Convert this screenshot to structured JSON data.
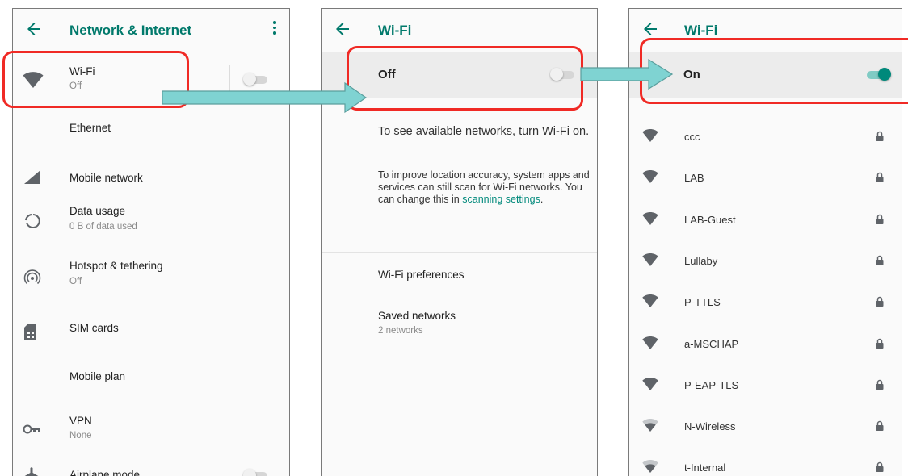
{
  "colors": {
    "accent": "#00796b",
    "highlight": "#f02a25",
    "arrow_fill": "#7fd3d2"
  },
  "screen1": {
    "title": "Network & Internet",
    "items": [
      {
        "label": "Wi-Fi",
        "sub": "Off",
        "icon": "wifi-icon"
      },
      {
        "label": "Ethernet",
        "icon": ""
      },
      {
        "label": "Mobile network",
        "icon": "signal-icon"
      },
      {
        "label": "Data usage",
        "sub": "0 B of data used",
        "icon": "data-usage-icon"
      },
      {
        "label": "Hotspot & tethering",
        "sub": "Off",
        "icon": "hotspot-icon"
      },
      {
        "label": "SIM cards",
        "icon": "sim-card-icon"
      },
      {
        "label": "Mobile plan",
        "icon": ""
      },
      {
        "label": "VPN",
        "sub": "None",
        "icon": "vpn-key-icon"
      },
      {
        "label": "Airplane mode",
        "icon": "airplane-icon"
      }
    ]
  },
  "screen2": {
    "title": "Wi-Fi",
    "switch_label": "Off",
    "message": "To see available networks, turn Wi-Fi on.",
    "info_text": "To improve location accuracy, system apps and services can still scan for Wi-Fi networks. You can change this in ",
    "info_link": "scanning settings",
    "info_end": ".",
    "prefs": "Wi-Fi preferences",
    "saved": "Saved networks",
    "saved_sub": "2 networks"
  },
  "screen3": {
    "title": "Wi-Fi",
    "switch_label": "On",
    "networks": [
      {
        "name": "ccc",
        "icon": "wifi-full-icon",
        "locked": true
      },
      {
        "name": "LAB",
        "icon": "wifi-full-icon",
        "locked": true
      },
      {
        "name": "LAB-Guest",
        "icon": "wifi-full-icon",
        "locked": true
      },
      {
        "name": "Lullaby",
        "icon": "wifi-full-icon",
        "locked": true
      },
      {
        "name": "P-TTLS",
        "icon": "wifi-full-icon",
        "locked": true
      },
      {
        "name": "a-MSCHAP",
        "icon": "wifi-full-icon",
        "locked": true
      },
      {
        "name": "P-EAP-TLS",
        "icon": "wifi-full-icon",
        "locked": true
      },
      {
        "name": "N-Wireless",
        "icon": "wifi-weak-icon",
        "locked": true
      },
      {
        "name": "t-Internal",
        "icon": "wifi-weak-icon",
        "locked": true
      }
    ]
  }
}
